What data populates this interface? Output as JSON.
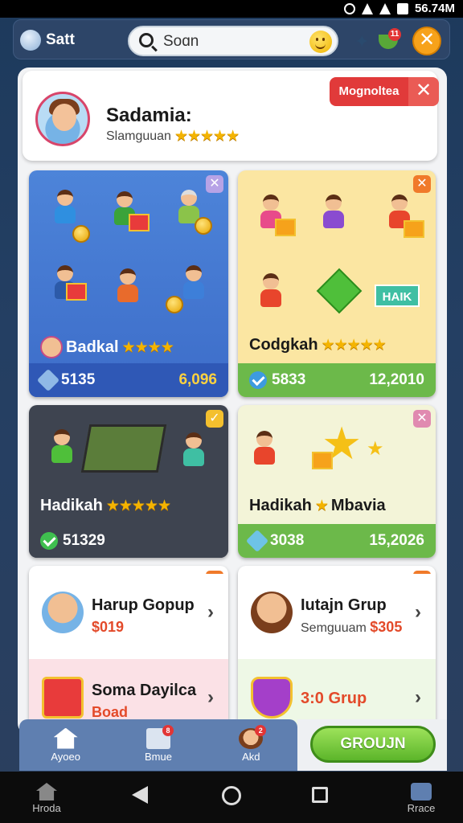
{
  "status_bar": {
    "time": "56.74M"
  },
  "header": {
    "brand": "Satt",
    "search_placeholder": "Soɑn",
    "notification_count": "11"
  },
  "profile": {
    "name": "Sadamia:",
    "subtitle": "Slamguuan",
    "rating_stars": 5,
    "promo_label": "Mognoltea"
  },
  "cards": [
    {
      "title": "Badkal",
      "stars": 4,
      "left_value": "5135",
      "right_value": "6,096",
      "footer_color": "#2f58b6"
    },
    {
      "title": "Codgkah",
      "stars": 5,
      "left_value": "5833",
      "right_value": "12,2010",
      "footer_color": "#6cb94a",
      "art_label": "HAIK"
    },
    {
      "title": "Hadikah",
      "stars": 5,
      "left_value": "51329",
      "right_value": ""
    },
    {
      "title": "Hadikah",
      "title_suffix": "Mbavia",
      "left_value": "3038",
      "right_value": "15,2026"
    }
  ],
  "list_left": [
    {
      "name": "Harup Gopup",
      "price": "$019"
    },
    {
      "name": "Soma Dayilca",
      "price": "Boad"
    }
  ],
  "list_right": [
    {
      "name": "Iutajn Grup",
      "sub": "Semguuam",
      "price": "$305"
    },
    {
      "name": "3:0 Grup"
    }
  ],
  "tabs": [
    {
      "label": "Ayoeo"
    },
    {
      "label": "Bmue",
      "badge": "8"
    },
    {
      "label": "Akd",
      "badge": "2"
    }
  ],
  "group_button": "GROUJN",
  "nav": {
    "left_label": "Hroda",
    "right_label": "Rrace"
  },
  "colors": {
    "accent_orange": "#f7a21b",
    "promo_red": "#e13a3a",
    "green": "#5cb52a"
  }
}
